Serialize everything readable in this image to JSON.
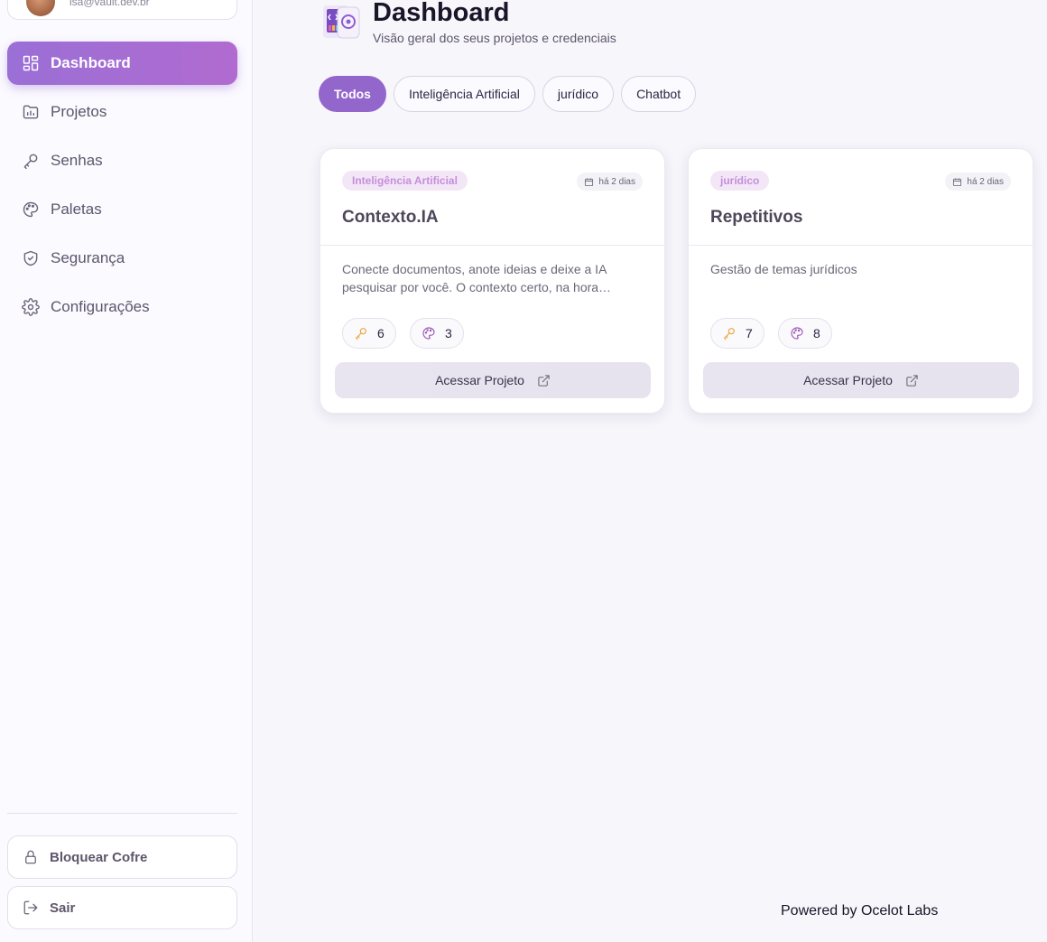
{
  "user": {
    "email": "isa@vault.dev.br"
  },
  "nav": {
    "items": [
      {
        "label": "Dashboard",
        "icon": "dashboard-icon",
        "active": true
      },
      {
        "label": "Projetos",
        "icon": "folder-chart-icon"
      },
      {
        "label": "Senhas",
        "icon": "key-icon"
      },
      {
        "label": "Paletas",
        "icon": "palette-icon"
      },
      {
        "label": "Segurança",
        "icon": "shield-icon"
      },
      {
        "label": "Configurações",
        "icon": "gear-icon"
      }
    ]
  },
  "sidebar_actions": {
    "lock_label": "Bloquear Cofre",
    "logout_label": "Sair"
  },
  "header": {
    "title": "Dashboard",
    "subtitle": "Visão geral dos seus projetos e credenciais"
  },
  "filters": [
    {
      "label": "Todos",
      "active": true
    },
    {
      "label": "Inteligência Artificial"
    },
    {
      "label": "jurídico"
    },
    {
      "label": "Chatbot"
    }
  ],
  "projects": [
    {
      "tag": "Inteligência Artificial",
      "date": "há 2 dias",
      "title": "Contexto.IA",
      "description": "Conecte documentos, anote ideias e deixe a IA pesquisar por você. O contexto certo, na hora…",
      "keys": "6",
      "palettes": "3",
      "action_label": "Acessar Projeto"
    },
    {
      "tag": "jurídico",
      "date": "há 2 dias",
      "title": "Repetitivos",
      "description": "Gestão de temas jurídicos",
      "keys": "7",
      "palettes": "8",
      "action_label": "Acessar Projeto"
    }
  ],
  "footer": {
    "text": "Powered by Ocelot Labs"
  },
  "colors": {
    "accent": "#9366cc",
    "nav_active_start": "#9a6fd6",
    "nav_active_end": "#b16bd0",
    "tag_bg": "#f3e6f7",
    "tag_text": "#c48fd9"
  }
}
